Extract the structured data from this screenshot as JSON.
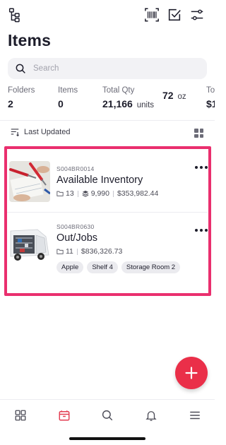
{
  "header": {
    "title": "Items",
    "icons": [
      "hierarchy-icon",
      "barcode-scan-icon",
      "checklist-icon",
      "filter-sliders-icon"
    ]
  },
  "search": {
    "placeholder": "Search"
  },
  "stats": [
    {
      "label": "Folders",
      "value": "2",
      "unit": ""
    },
    {
      "label": "Items",
      "value": "0",
      "unit": ""
    },
    {
      "label": "Total Qty",
      "value": "21,166",
      "unit": "units"
    },
    {
      "label": "",
      "value": "72",
      "unit": "oz"
    },
    {
      "label": "To",
      "value": "$1",
      "unit": ""
    }
  ],
  "sort": {
    "label": "Last Updated"
  },
  "items": [
    {
      "sku": "S004BR0014",
      "name": "Available Inventory",
      "folders": "13",
      "quantity": "9,990",
      "value": "$353,982.44",
      "tags": []
    },
    {
      "sku": "S004BR0630",
      "name": "Out/Jobs",
      "folders": "11",
      "value": "$836,326.73",
      "tags": [
        "Apple",
        "Shelf 4",
        "Storage Room 2"
      ]
    }
  ],
  "nav": [
    "dashboard-icon",
    "items-icon",
    "search-icon",
    "notifications-icon",
    "menu-icon"
  ],
  "colors": {
    "accent": "#ea2f49",
    "highlight": "#ea2f6e",
    "active_nav": "#e33b50"
  }
}
